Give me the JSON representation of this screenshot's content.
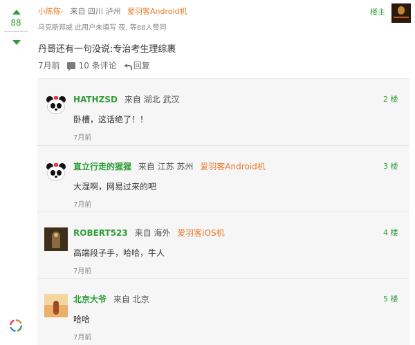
{
  "vote": {
    "count": "88"
  },
  "post": {
    "username": "小陈陈-",
    "from_label": "来自",
    "location": "四川 泸州",
    "device": "爱羽客Android机",
    "floor_label": "楼主",
    "subtitle": "马克斯邦威 此用户未填写 夜. 等88人赞同",
    "body": "丹哥还有一句没说:专治考生理综裹",
    "time": "7月前",
    "comments_label": "10 条评论",
    "reply_label": "回复"
  },
  "replies": [
    {
      "name": "HATHZSD",
      "from": "来自",
      "location": "湖北 武汉",
      "device": "",
      "floor": "2 楼",
      "body": "卧槽，这话绝了！！",
      "time": "7月前",
      "avatar": "panda-icon"
    },
    {
      "name": "直立行走的猩猩",
      "from": "来自",
      "location": "江苏 苏州",
      "device": "爱羽客Android机",
      "floor": "3 楼",
      "body": "大湿啊，网易过来的吧",
      "time": "7月前",
      "avatar": "panda-icon"
    },
    {
      "name": "ROBERT523",
      "from": "来自",
      "location": "海外",
      "device": "爱羽客iOS机",
      "floor": "4 楼",
      "body": "高端段子手，哈哈，牛人",
      "time": "7月前",
      "avatar": "photo-dark"
    },
    {
      "name": "北京大爷",
      "from": "来自",
      "location": "北京",
      "device": "",
      "floor": "5 楼",
      "body": "哈哈",
      "time": "7月前",
      "avatar": "photo-warm"
    }
  ],
  "colors": {
    "green": "#2f9e3a",
    "orange": "#e6792a",
    "reply_bg": "#f6f6f6"
  }
}
